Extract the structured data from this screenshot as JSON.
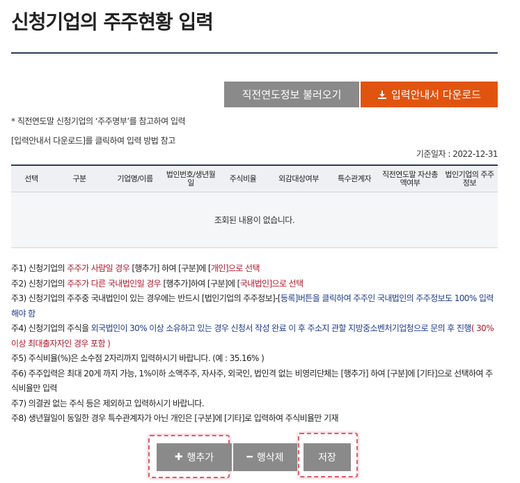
{
  "page": {
    "title": "신청기업의 주주현황 입력"
  },
  "toolbar": {
    "load_prev_label": "직전연도정보 불러오기",
    "download_guide_label": "입력안내서 다운로드"
  },
  "notes_top": {
    "line1": "* 직전연도말 신청기업의 ‘주주명부’를 참고하여 입력",
    "line2": "[입력안내서 다운로드]를 클릭하여 입력 방법 참고",
    "base_date": "기준일자 : 2022-12-31"
  },
  "table": {
    "headers": [
      "선택",
      "구분",
      "기업명/이름",
      "법인번호/생년월일",
      "주식비율",
      "외감대상여부",
      "특수관계자",
      "직전연도말 자산총액여부",
      "법인기업의 주주정보"
    ],
    "empty_message": "조회된 내용이 없습니다."
  },
  "footnotes": {
    "n1": {
      "a": "주1) 신청기업의 ",
      "b": "주주가 사람일 경우",
      "c": " [행추가] 하여 [구분]에 [",
      "d": "개인",
      "e": "]으로 선택"
    },
    "n2": {
      "a": "주2) 신청기업의 ",
      "b": "주주가 다른 국내법인일 경우",
      "c": " [행추가]하여 [구분]에 [",
      "d": "국내법인",
      "e": "]으로 선택"
    },
    "n3": {
      "a": "주3) 신청기업의 주주중 국내법인이 있는 경우에는 반드시 [법인기업의 주주정보]-[",
      "b": "등록",
      "c": "]버튼을 클릭하여 주주인 국내법인의 주주정보도 100% 입력해야 함"
    },
    "n4": {
      "a": "주4) 신청기업의 주식을 ",
      "b": "외국법인이 30% 이상 소유하고 있는 경우 신청서 작성 완료 이 후 주소지 관할 지방중소벤처기업청으로 문의 후 진행",
      "c": "( 30%이상 최대출자자인 경우 포함 )"
    },
    "n5": "주5) 주식비율(%)은 소수점 2자리까지 입력하시기 바랍니다. (예 : 35.16% )",
    "n6": "주6) 주주입력은 최대 20게 까지 가능, 1%이하 소액주주, 자사주, 외국인, 법인격 없는 비영리단체는 [행추가] 하여 [구분]에 [기타]으로 선택하여 주식비율만 입력",
    "n7": "주7) 의결권 없는 주식 등은 제외하고 입력하시기 바랍니다.",
    "n8": "주8) 생년월일이 동일한 경우 특수관계자가 아닌 개인은 [구분]에 [기타]로 입력하여 주식비율만 기재"
  },
  "actions": {
    "add_row_label": "행추가",
    "delete_row_label": "행삭제",
    "save_label": "저장"
  },
  "colors": {
    "primary": "#2b3a5c",
    "accent": "#e0540f",
    "button_gray": "#8a8a8a",
    "red_text": "#b0182b",
    "blue_text": "#1f3b8c",
    "highlight": "#e05a6a"
  },
  "icons": {
    "download": "download-icon",
    "add": "plus-icon",
    "delete": "minus-icon"
  }
}
